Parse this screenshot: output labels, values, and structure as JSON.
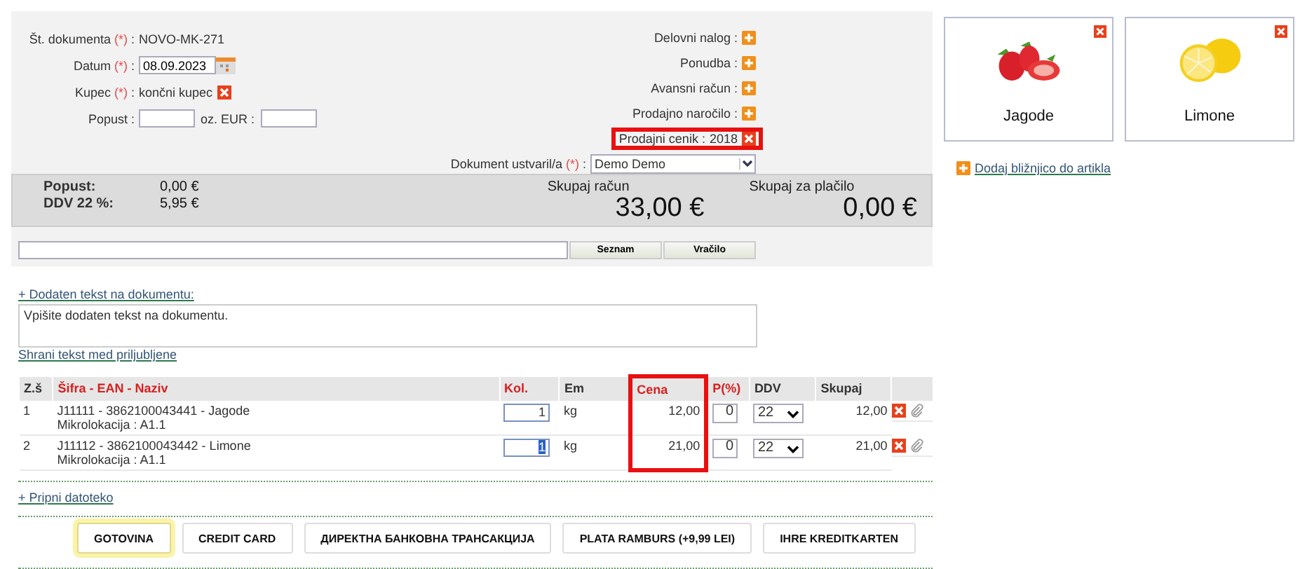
{
  "form": {
    "left": [
      {
        "kind": "text",
        "label": "Št. dokumenta",
        "required": true,
        "value": "NOVO-MK-271"
      },
      {
        "kind": "date",
        "label": "Datum",
        "required": true,
        "value": "08.09.2023"
      },
      {
        "kind": "removable",
        "label": "Kupec",
        "required": true,
        "value": "končni kupec"
      },
      {
        "kind": "amounts",
        "label": "Popust",
        "required": false,
        "second_label": "oz. EUR :"
      }
    ],
    "required_mark": "(*)",
    "separator": ":",
    "right": [
      {
        "kind": "add",
        "label": "Delovni nalog",
        "required": false,
        "highlighted": false
      },
      {
        "kind": "add",
        "label": "Ponudba",
        "required": false,
        "highlighted": false
      },
      {
        "kind": "add",
        "label": "Avansni račun",
        "required": false,
        "highlighted": false
      },
      {
        "kind": "add",
        "label": "Prodajno naročilo",
        "required": false,
        "highlighted": false
      },
      {
        "kind": "removable",
        "label": "Prodajni cenik",
        "value": "2018",
        "required": false,
        "highlighted": true
      },
      {
        "kind": "select",
        "label": "Dokument ustvaril/a",
        "value": "Demo Demo",
        "required": true,
        "highlighted": false
      }
    ]
  },
  "summary": {
    "rows": [
      {
        "label": "Popust:",
        "value": "0,00 €"
      },
      {
        "label": "DDV 22 %:",
        "value": "5,95 €"
      }
    ],
    "totals": [
      {
        "label": "Skupaj račun",
        "value": "33,00 €"
      },
      {
        "label": "Skupaj za plačilo",
        "value": "0,00 €"
      }
    ]
  },
  "search": {
    "buttons": [
      "Seznam",
      "Vračilo"
    ]
  },
  "note": {
    "link": "+ Dodaten tekst na dokumentu:",
    "placeholder": "Vpišite dodaten tekst na dokumentu.",
    "save_link": "Shrani tekst med priljubljene"
  },
  "table": {
    "columns": [
      {
        "label": "Z.š",
        "required": false,
        "highlighted": false
      },
      {
        "label": "Šifra - EAN - Naziv",
        "required": true,
        "highlighted": false
      },
      {
        "label": "Kol.",
        "required": true,
        "highlighted": false
      },
      {
        "label": "Em",
        "required": false,
        "highlighted": false
      },
      {
        "label": "Cena",
        "required": true,
        "highlighted": true
      },
      {
        "label": "P(%)",
        "required": true,
        "highlighted": false
      },
      {
        "label": "DDV",
        "required": false,
        "highlighted": false
      },
      {
        "label": "Skupaj",
        "required": false,
        "highlighted": false
      }
    ],
    "rows": [
      {
        "index": "1",
        "item": "J11111 - 3862100043441 - Jagode",
        "location": "Mikrolokacija : A1.1",
        "qty": "1",
        "focused": false,
        "unit": "kg",
        "price": "12,00",
        "discount": "0",
        "vat": "22",
        "total": "12,00"
      },
      {
        "index": "2",
        "item": "J11112 - 3862100043442 - Limone",
        "location": "Mikrolokacija : A1.1",
        "qty": "1",
        "focused": true,
        "unit": "kg",
        "price": "21,00",
        "discount": "0",
        "vat": "22",
        "total": "21,00"
      }
    ]
  },
  "attach_link": "+ Pripni datoteko",
  "payments": [
    {
      "label": "GOTOVINA",
      "selected": true
    },
    {
      "label": "CREDIT CARD",
      "selected": false
    },
    {
      "label": "ДИРЕКТНА БАНКОВНА ТРАНСАКЦИЈА",
      "selected": false
    },
    {
      "label": "PLATA RAMBURS (+9,99 LEI)",
      "selected": false
    },
    {
      "label": "IHRE KREDITKARTEN",
      "selected": false
    }
  ],
  "shortcuts": [
    {
      "name": "Jagode",
      "kind": "strawberry"
    },
    {
      "name": "Limone",
      "kind": "lemon"
    }
  ],
  "add_shortcut_link": "Dodaj bližnjico do artikla"
}
